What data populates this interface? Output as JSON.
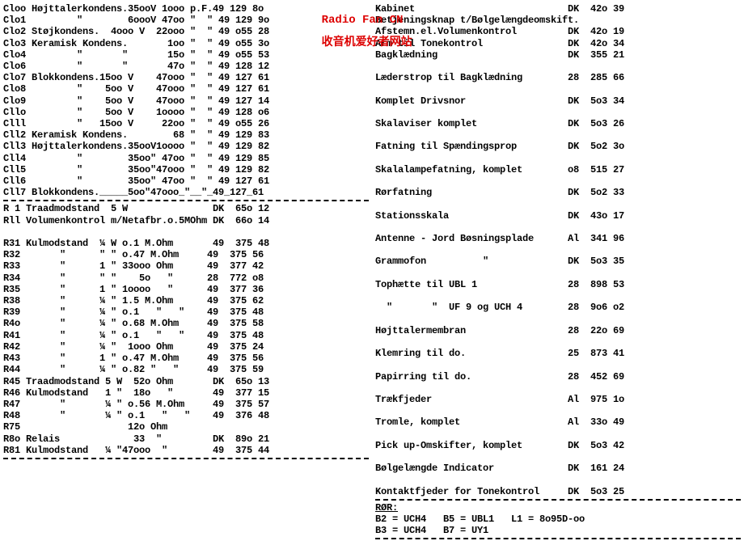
{
  "watermark": {
    "line1": "Radio Fan CN",
    "line2": "收音机爱好者网站"
  },
  "left": {
    "caps": [
      "Cloo Højttalerkondens.35ooV 1ooo p.F.49 129 8o",
      "Clo1         \"        6oooV 47oo \"  \" 49 129 9o",
      "Clo2 Støjkondens.  4ooo V  22ooo \"  \" 49 o55 28",
      "Clo3 Keramisk Kondens.       1oo \"  \" 49 o55 3o",
      "Clo4         \"       \"       15o \"  \" 49 o55 53",
      "Clo6         \"       \"       47o \"  \" 49 128 12",
      "Clo7 Blokkondens.15oo V    47ooo \"  \" 49 127 61",
      "Clo8         \"    5oo V    47ooo \"  \" 49 127 61",
      "Clo9         \"    5oo V    47ooo \"  \" 49 127 14",
      "Cllo         \"    5oo V    1oooo \"  \" 49 128 o6",
      "Clll         \"   15oo V     22oo \"  \" 49 o55 26",
      "Cll2 Keramisk Kondens.        68 \"  \" 49 129 83",
      "Cll3 Højttalerkondens.35ooV1oooo \"  \" 49 129 82",
      "Cll4         \"        35oo\" 47oo \"  \" 49 129 85",
      "Cll5         \"        35oo\"47ooo \"  \" 49 129 82",
      "Cll6         \"        35oo\" 47oo \"  \" 49 127 61",
      "Cll7 Blokkondens._____5oo\"47ooo_\"__\"_49_127_61"
    ],
    "res_a": [
      "R 1 Traadmodstand  5 W               DK  65o 12",
      "Rll Volumenkontrol m/Netafbr.o.5MOhm DK  66o 14"
    ],
    "res_b": [
      "R31 Kulmodstand  ¼ W o.1 M.Ohm       49  375 48",
      "R32       \"      \" \" o.47 M.Ohm     49  375 56",
      "R33       \"      1 \" 33ooo Ohm      49  377 42",
      "R34       \"      \" \"    5o   \"      28  772 o8",
      "R35       \"      1 \" 1oooo   \"      49  377 36",
      "R38       \"      ¼ \" 1.5 M.Ohm      49  375 62",
      "R39       \"      ¼ \" o.1   \"   \"    49  375 48",
      "R4o       \"      ¼ \" o.68 M.Ohm     49  375 58",
      "R41       \"      ¼ \" o.1   \"   \"    49  375 48",
      "R42       \"      ¼ \"  1ooo Ohm      49  375 24",
      "R43       \"      1 \" o.47 M.Ohm     49  375 56",
      "R44       \"      ¼ \" o.82 \"   \"     49  375 59",
      "R45 Traadmodstand 5 W  52o Ohm       DK  65o 13",
      "R46 Kulmodstand   1 \"  18o   \"       49  377 15",
      "R47       \"       ¼ \" o.56 M.Ohm     49  375 57",
      "R48       \"       ¼ \" o.1   \"   \"    49  376 48",
      "R75                   12o Ohm",
      "R8o Relais             33  \"         DK  89o 21",
      "R81 Kulmodstand   ¼ \"47ooo  \"        49  375 44"
    ]
  },
  "right": {
    "parts": [
      "Kabinet                           DK  42o 39",
      "Betjeningsknap t/Bølgelængdeomskift.",
      "Afstemn.el.Volumenkontrol         DK  42o 19",
      "Arm til Tonekontrol               DK  42o 34",
      "Bagklædning                       DK  355 21",
      "",
      "Læderstrop til Bagklædning        28  285 66",
      "",
      "Komplet Drivsnor                  DK  5o3 34",
      "",
      "Skalaviser komplet                DK  5o3 26",
      "",
      "Fatning til Spændingsprop         DK  5o2 3o",
      "",
      "Skalalampefatning, komplet        o8  515 27",
      "",
      "Rørfatning                        DK  5o2 33",
      "",
      "Stationsskala                     DK  43o 17",
      "",
      "Antenne - Jord Bøsningsplade      Al  341 96",
      "",
      "Grammofon          \"              DK  5o3 35",
      "",
      "Tophætte til UBL 1                28  898 53",
      "",
      "  \"       \"  UF 9 og UCH 4        28  9o6 o2",
      "",
      "Højttalermembran                  28  22o 69",
      "",
      "Klemring til do.                  25  873 41",
      "",
      "Papirring til do.                 28  452 69",
      "",
      "Trækfjeder                        Al  975 1o",
      "",
      "Tromle, komplet                   Al  33o 49",
      "",
      "Pick up-Omskifter, komplet        DK  5o3 42",
      "",
      "Bølgelængde Indicator             DK  161 24",
      "",
      "Kontaktfjeder for Tonekontrol     DK  5o3 25"
    ],
    "tubes_heading": "RØR:",
    "tubes": [
      "B2 = UCH4   B5 = UBL1   L1 = 8o95D-oo",
      "B3 = UCH4   B7 = UY1"
    ]
  }
}
